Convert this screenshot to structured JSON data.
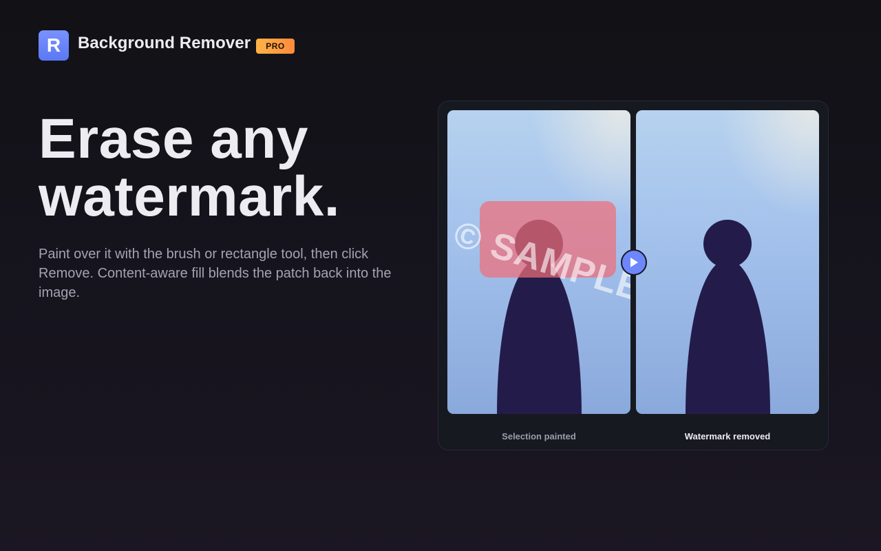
{
  "header": {
    "logo_letter": "R",
    "app_name": "Background Remover",
    "badge": "PRO"
  },
  "hero": {
    "headline_line1": "Erase any",
    "headline_line2": "watermark.",
    "description": "Paint over it with the brush or rectangle tool, then click Remove. Content-aware fill blends the patch back into the image."
  },
  "demo": {
    "before_caption": "Selection painted",
    "after_caption": "Watermark removed",
    "watermark_text": "© SAMPLE",
    "play_icon": "play-icon",
    "colors": {
      "accent": "#6d86fb",
      "selection": "#f06e78",
      "silhouette": "#231c4a"
    }
  }
}
